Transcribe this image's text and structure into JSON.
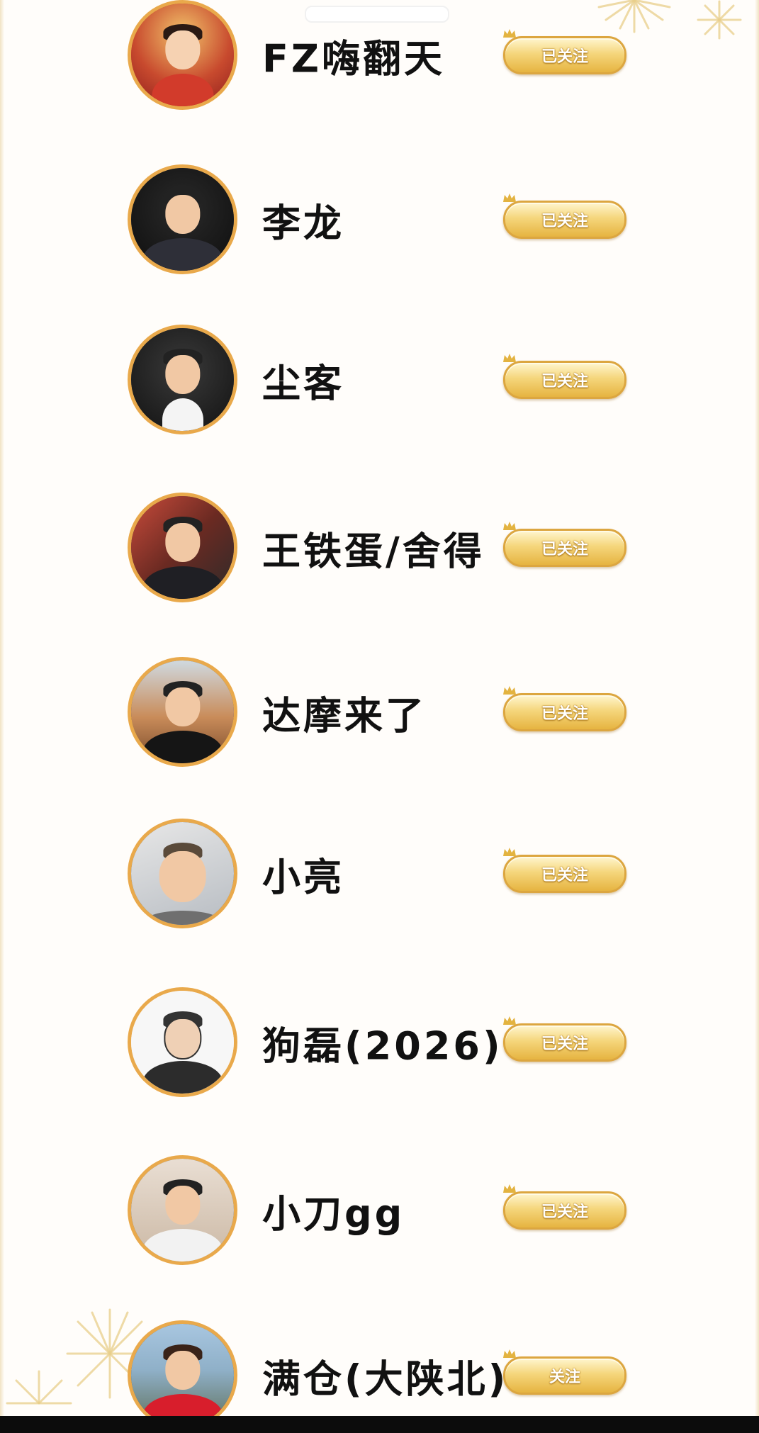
{
  "users": [
    {
      "name": "FZ嗨翻天",
      "button": "已关注",
      "avatar_icon": "baby-figurine-avatar-icon"
    },
    {
      "name": "李龙",
      "button": "已关注",
      "avatar_icon": "man-suit-avatar-icon"
    },
    {
      "name": "尘客",
      "button": "已关注",
      "avatar_icon": "man-bowtie-avatar-icon"
    },
    {
      "name": "王铁蛋/舍得",
      "button": "已关注",
      "avatar_icon": "man-sunglasses-avatar-icon"
    },
    {
      "name": "达摩来了",
      "button": "已关注",
      "avatar_icon": "man-desert-avatar-icon"
    },
    {
      "name": "小亮",
      "button": "已关注",
      "avatar_icon": "man-selfie-avatar-icon"
    },
    {
      "name": "狗磊(2026)",
      "button": "已关注",
      "avatar_icon": "man-cartoon-avatar-icon"
    },
    {
      "name": "小刀gg",
      "button": "已关注",
      "avatar_icon": "man-mirror-avatar-icon"
    },
    {
      "name": "满仓(大陕北)",
      "button": "关注",
      "avatar_icon": "woman-red-dress-avatar-icon"
    }
  ],
  "colors": {
    "avatar_border": "#e9a94b",
    "button_gold": "#f5d67c",
    "background": "#fffdfa"
  }
}
